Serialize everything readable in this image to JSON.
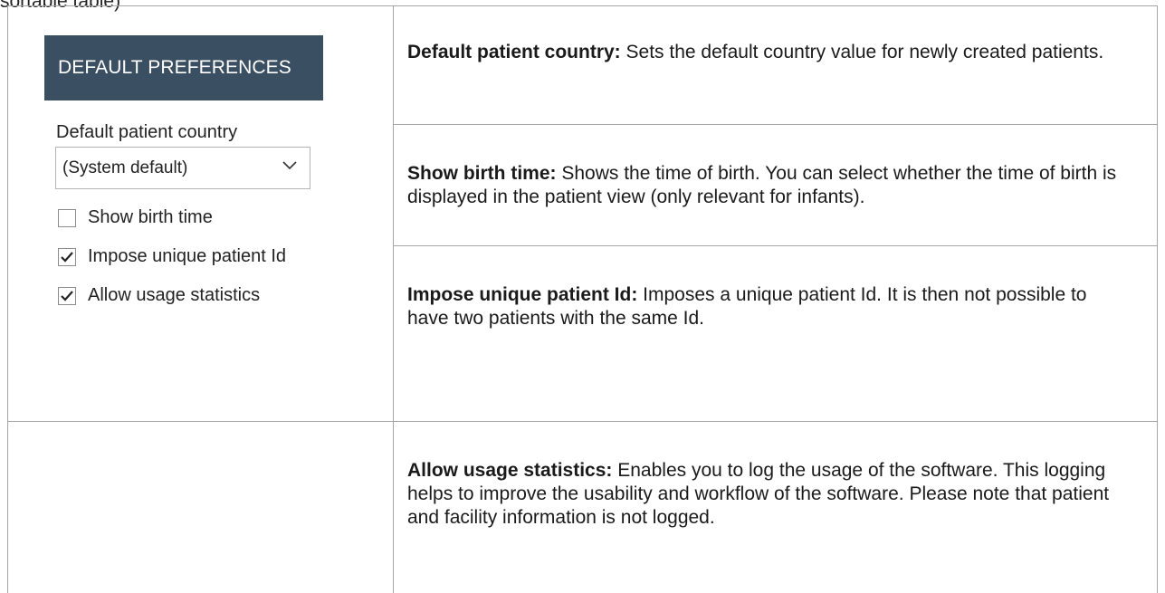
{
  "top_fragment": "sortable table)",
  "panel": {
    "header": "DEFAULT PREFERENCES",
    "country_label": "Default patient country",
    "country_value": "(System default)",
    "checkboxes": [
      {
        "label": "Show birth time",
        "checked": false
      },
      {
        "label": "Impose unique patient Id",
        "checked": true
      },
      {
        "label": "Allow usage statistics",
        "checked": true
      }
    ]
  },
  "descriptions": [
    {
      "term": "Default patient country:",
      "text": " Sets the default country value for newly created patients."
    },
    {
      "term": "Show birth time:",
      "text": " Shows the time of birth. You can select whether the time of birth is displayed in the patient view (only relevant for infants)."
    },
    {
      "term": "Impose unique patient Id:",
      "text": " Imposes a unique patient Id. It is then not possible to have two patients with the same Id."
    },
    {
      "term": "Allow usage statistics:",
      "text": " Enables you to log the usage of the software. This logging helps to improve the usability and workflow of the software. Please note that patient and facility information is not logged."
    }
  ],
  "colors": {
    "header_bg": "#3b4f63",
    "border": "#a6a6a6"
  }
}
